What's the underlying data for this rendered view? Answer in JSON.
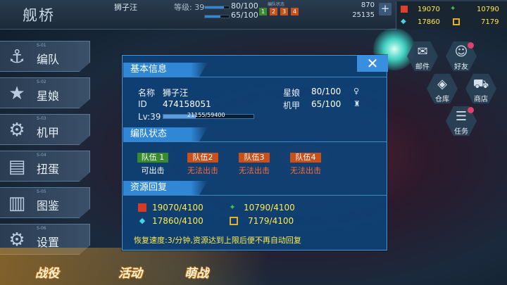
{
  "topbar": {
    "title": "舰桥",
    "player_name": "狮子汪",
    "level_label": "等级: 39",
    "star_girl_count": "80/100",
    "mecha_count": "65/100",
    "fleet_status_label": "编队状态",
    "fleet_slots": [
      "1",
      "2",
      "3",
      "4"
    ],
    "right_top_value": "870",
    "right_bottom_value": "25135",
    "plus_label": "+",
    "res": {
      "red": "19070",
      "green": "10790",
      "blue": "17860",
      "gold": "7179"
    }
  },
  "menu": [
    {
      "num": "S-01",
      "label": "编队"
    },
    {
      "num": "S-02",
      "label": "星娘"
    },
    {
      "num": "S-03",
      "label": "机甲"
    },
    {
      "num": "S-04",
      "label": "扭蛋"
    },
    {
      "num": "S-05",
      "label": "图鉴"
    },
    {
      "num": "S-06",
      "label": "设置"
    }
  ],
  "right_buttons": [
    {
      "label": "邮件",
      "icon": "mail-icon"
    },
    {
      "label": "好友",
      "icon": "friend-icon"
    },
    {
      "label": "仓库",
      "icon": "warehouse-icon"
    },
    {
      "label": "商店",
      "icon": "cart-icon"
    },
    {
      "label": "任务",
      "icon": "task-icon"
    }
  ],
  "bottom": {
    "battle": "战役",
    "event": "活动",
    "arena": "萌战"
  },
  "dialog": {
    "close_label": "✕",
    "basic": {
      "header": "基本信息",
      "name_label": "名称",
      "name_value": "狮子汪",
      "id_label": "ID",
      "id_value": "474158051",
      "lv_label": "Lv:39",
      "exp_text": "21155/59400",
      "exp_fraction": 0.356,
      "star_label": "星娘",
      "star_value": "80/100",
      "mecha_label": "机甲",
      "mecha_value": "65/100"
    },
    "fleet": {
      "header": "编队状态",
      "teams": [
        {
          "label": "队伍 1",
          "status": "可出击",
          "color": "#3a8a2e",
          "status_color": "#ffffff"
        },
        {
          "label": "队伍2",
          "status": "无法出击",
          "color": "#c8501a",
          "status_color": "#ff6a3a"
        },
        {
          "label": "队伍3",
          "status": "无法出击",
          "color": "#c8501a",
          "status_color": "#ff6a3a"
        },
        {
          "label": "队伍4",
          "status": "无法出击",
          "color": "#c8501a",
          "status_color": "#ff6a3a"
        }
      ]
    },
    "resource": {
      "header": "资源回复",
      "items": [
        {
          "value": "19070/4100",
          "icon": "red-cube-icon"
        },
        {
          "value": "10790/4100",
          "icon": "green-bolt-icon"
        },
        {
          "value": "17860/4100",
          "icon": "blue-gem-icon"
        },
        {
          "value": "7179/4100",
          "icon": "gold-box-icon"
        }
      ],
      "recovery_text": "恢复速度:3/分钟,资源达到上限后便不再自动回复"
    }
  }
}
